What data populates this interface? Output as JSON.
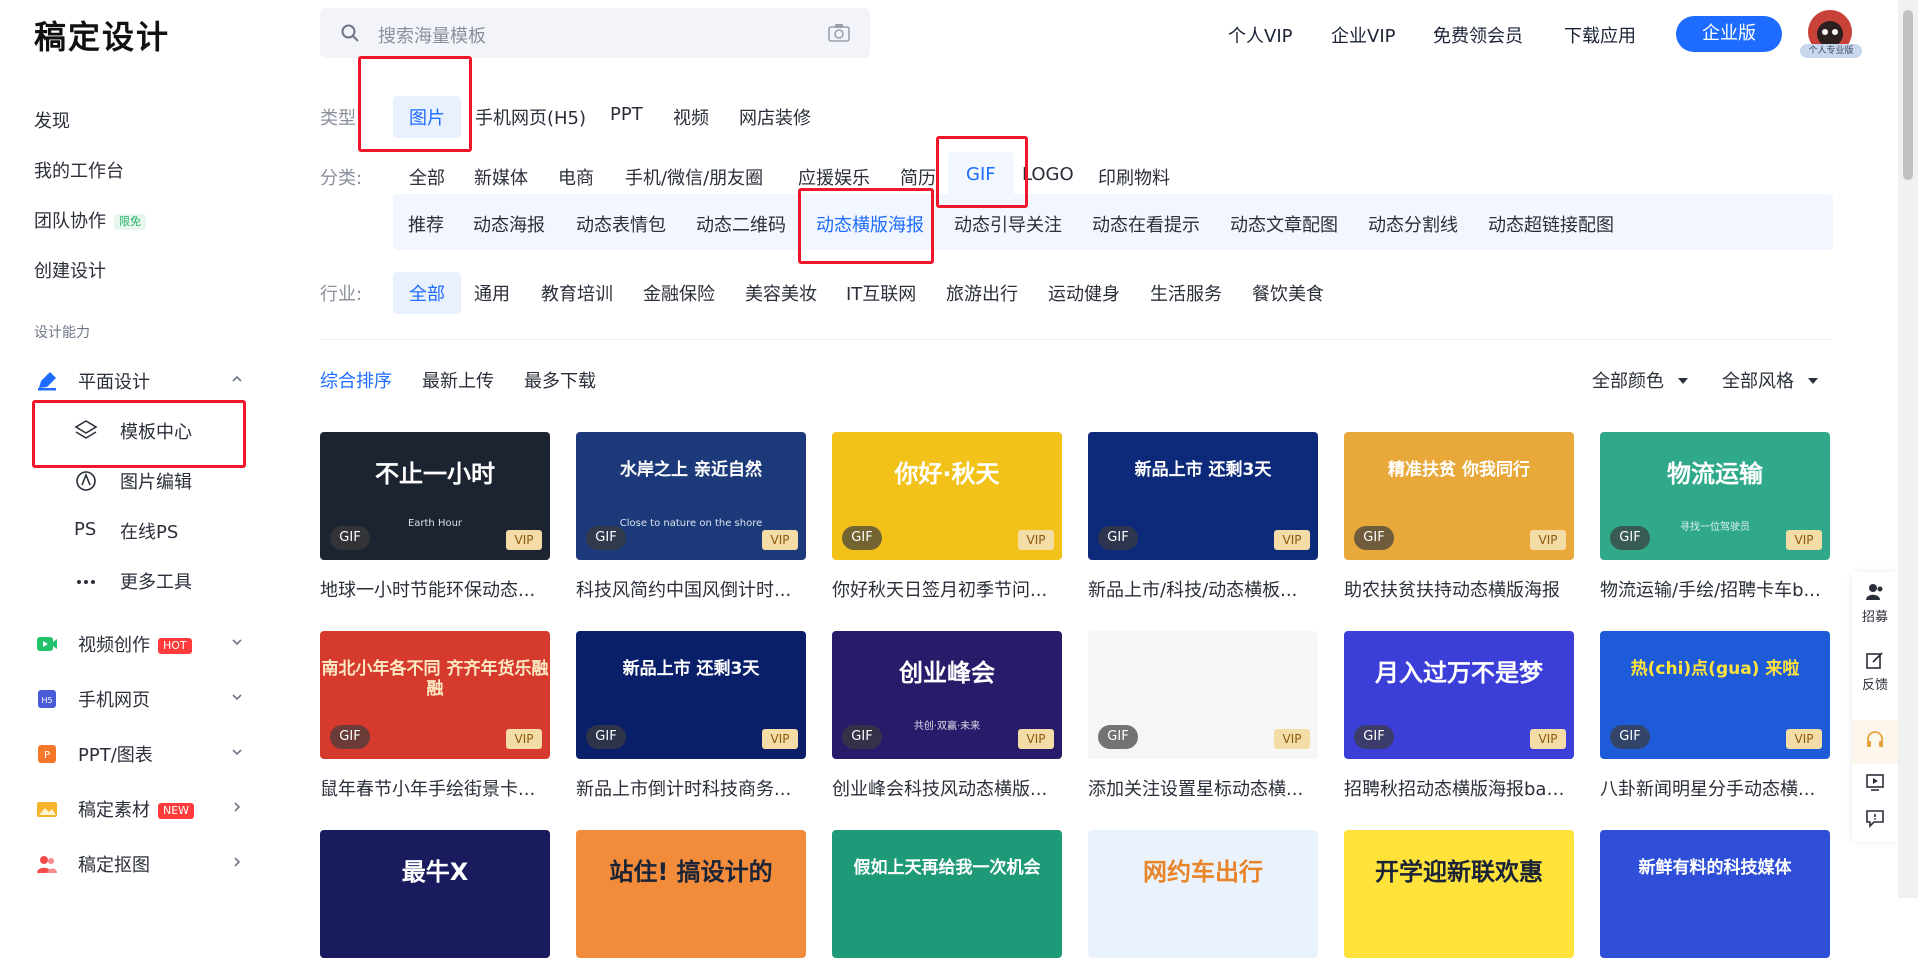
{
  "brand": {
    "logo": "稿定设计"
  },
  "search": {
    "placeholder": "搜索海量模板"
  },
  "topnav": {
    "personal_vip": "个人VIP",
    "enterprise_vip": "企业VIP",
    "free_member": "免费领会员",
    "download_app": "下载应用",
    "enterprise_btn": "企业版",
    "avatar_badge": "个人专业版"
  },
  "sidebar": {
    "discover": "发现",
    "workbench": "我的工作台",
    "team": "团队协作",
    "team_badge": "限免",
    "create": "创建设计",
    "section_caption": "设计能力",
    "graphic": "平面设计",
    "template_center": "模板中心",
    "image_edit": "图片编辑",
    "online_ps_icon": "PS",
    "online_ps": "在线PS",
    "more_tools": "更多工具",
    "video": "视频创作",
    "video_badge": "HOT",
    "mobile_web": "手机网页",
    "ppt": "PPT/图表",
    "materials": "稿定素材",
    "materials_badge": "NEW",
    "cutout": "稿定抠图"
  },
  "filters": {
    "type_label": "类型:",
    "types": [
      "图片",
      "手机网页(H5)",
      "PPT",
      "视频",
      "网店装修"
    ],
    "category_label": "分类:",
    "categories": [
      "全部",
      "新媒体",
      "电商",
      "手机/微信/朋友圈",
      "应援娱乐",
      "简历",
      "GIF",
      "LOGO",
      "印刷物料"
    ],
    "subcategories": [
      "推荐",
      "动态海报",
      "动态表情包",
      "动态二维码",
      "动态横版海报",
      "动态引导关注",
      "动态在看提示",
      "动态文章配图",
      "动态分割线",
      "动态超链接配图"
    ],
    "industry_label": "行业:",
    "industries": [
      "全部",
      "通用",
      "教育培训",
      "金融保险",
      "美容美妆",
      "IT互联网",
      "旅游出行",
      "运动健身",
      "生活服务",
      "餐饮美食"
    ]
  },
  "sort": {
    "options": [
      "综合排序",
      "最新上传",
      "最多下载"
    ],
    "color": "全部颜色",
    "style": "全部风格"
  },
  "cards": [
    {
      "title": "地球一小时节能环保动态...",
      "thumb_text": "不止一小时",
      "thumb_sub": "Earth Hour",
      "bg": "#1d2431",
      "fg": "#ffffff"
    },
    {
      "title": "科技风简约中国风倒计时...",
      "thumb_text": "水岸之上 亲近自然",
      "thumb_sub": "Close to nature on the shore",
      "bg": "#1c3a7a",
      "fg": "#ffffff"
    },
    {
      "title": "你好秋天日签月初季节问...",
      "thumb_text": "你好·秋天",
      "thumb_sub": "",
      "bg": "#f3c21a",
      "fg": "#ffffff"
    },
    {
      "title": "新品上市/科技/动态横板...",
      "thumb_text": "新品上市 还剩3天",
      "thumb_sub": "",
      "bg": "#0d2a7a",
      "fg": "#ffffff"
    },
    {
      "title": "助农扶贫扶持动态横版海报",
      "thumb_text": "精准扶贫 你我同行",
      "thumb_sub": "",
      "bg": "#e9a83a",
      "fg": "#ffffff"
    },
    {
      "title": "物流运输/手绘/招聘卡车b...",
      "thumb_text": "物流运输",
      "thumb_sub": "寻找一位驾驶员",
      "bg": "#2fa98a",
      "fg": "#ffffff"
    },
    {
      "title": "鼠年春节小年手绘街景卡...",
      "thumb_text": "南北小年各不同 齐齐年货乐融融",
      "thumb_sub": "",
      "bg": "#d63a2c",
      "fg": "#fbe9c4"
    },
    {
      "title": "新品上市倒计时科技商务...",
      "thumb_text": "新品上市 还剩3天",
      "thumb_sub": "",
      "bg": "#0a1f6a",
      "fg": "#ffffff"
    },
    {
      "title": "创业峰会科技风动态横版...",
      "thumb_text": "创业峰会",
      "thumb_sub": "共创·双赢·未来",
      "bg": "#2a1a6a",
      "fg": "#ffffff"
    },
    {
      "title": "添加关注设置星标动态横...",
      "thumb_text": "",
      "thumb_sub": "",
      "bg": "#f6f6f4",
      "fg": "#333333"
    },
    {
      "title": "招聘秋招动态横版海报ban...",
      "thumb_text": "月入过万不是梦",
      "thumb_sub": "",
      "bg": "#3b3fd8",
      "fg": "#ffffff"
    },
    {
      "title": "八卦新闻明星分手动态横...",
      "thumb_text": "热(chi)点(gua) 来啦",
      "thumb_sub": "",
      "bg": "#1e5bd8",
      "fg": "#ffe23a"
    },
    {
      "title": "",
      "thumb_text": "最牛X",
      "thumb_sub": "",
      "bg": "#1a1a5e",
      "fg": "#ffffff"
    },
    {
      "title": "",
      "thumb_text": "站住! 搞设计的",
      "thumb_sub": "",
      "bg": "#f28c3a",
      "fg": "#1b2337"
    },
    {
      "title": "",
      "thumb_text": "假如上天再给我一次机会",
      "thumb_sub": "",
      "bg": "#1f9a78",
      "fg": "#ffffff"
    },
    {
      "title": "",
      "thumb_text": "网约车出行",
      "thumb_sub": "",
      "bg": "#eaf3fb",
      "fg": "#e8842a"
    },
    {
      "title": "",
      "thumb_text": "开学迎新联欢惠",
      "thumb_sub": "",
      "bg": "#ffe23a",
      "fg": "#1b2337"
    },
    {
      "title": "",
      "thumb_text": "新鲜有料的科技媒体",
      "thumb_sub": "",
      "bg": "#2f4fd8",
      "fg": "#ffffff"
    }
  ],
  "tags": {
    "gif": "GIF",
    "vip": "VIP"
  },
  "rail": {
    "recruit": "招募",
    "feedback": "反馈"
  }
}
